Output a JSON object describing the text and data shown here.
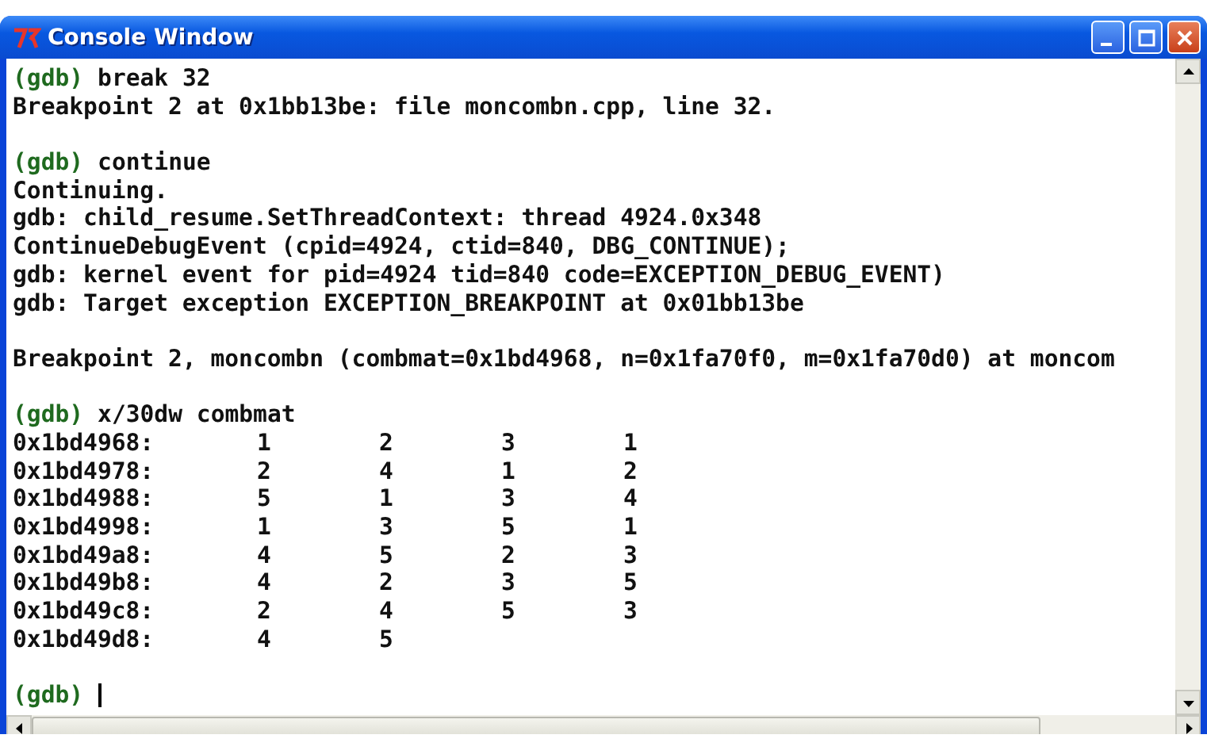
{
  "window": {
    "title": "Console Window"
  },
  "console": {
    "lines": [
      {
        "kind": "prompt",
        "prompt": "(gdb)",
        "command": "break 32"
      },
      {
        "kind": "output",
        "text": "Breakpoint 2 at 0x1bb13be: file moncombn.cpp, line 32."
      },
      {
        "kind": "blank"
      },
      {
        "kind": "prompt",
        "prompt": "(gdb)",
        "command": "continue"
      },
      {
        "kind": "output",
        "text": "Continuing."
      },
      {
        "kind": "output",
        "text": "gdb: child_resume.SetThreadContext: thread 4924.0x348"
      },
      {
        "kind": "output",
        "text": "ContinueDebugEvent (cpid=4924, ctid=840, DBG_CONTINUE);"
      },
      {
        "kind": "output",
        "text": "gdb: kernel event for pid=4924 tid=840 code=EXCEPTION_DEBUG_EVENT)"
      },
      {
        "kind": "output",
        "text": "gdb: Target exception EXCEPTION_BREAKPOINT at 0x01bb13be"
      },
      {
        "kind": "blank"
      },
      {
        "kind": "output",
        "text": "Breakpoint 2, moncombn (combmat=0x1bd4968, n=0x1fa70f0, m=0x1fa70d0) at moncom"
      },
      {
        "kind": "blank"
      },
      {
        "kind": "prompt",
        "prompt": "(gdb)",
        "command": "x/30dw combmat"
      },
      {
        "kind": "memory",
        "address": "0x1bd4968:",
        "values": [
          "1",
          "2",
          "3",
          "1"
        ]
      },
      {
        "kind": "memory",
        "address": "0x1bd4978:",
        "values": [
          "2",
          "4",
          "1",
          "2"
        ]
      },
      {
        "kind": "memory",
        "address": "0x1bd4988:",
        "values": [
          "5",
          "1",
          "3",
          "4"
        ]
      },
      {
        "kind": "memory",
        "address": "0x1bd4998:",
        "values": [
          "1",
          "3",
          "5",
          "1"
        ]
      },
      {
        "kind": "memory",
        "address": "0x1bd49a8:",
        "values": [
          "4",
          "5",
          "2",
          "3"
        ]
      },
      {
        "kind": "memory",
        "address": "0x1bd49b8:",
        "values": [
          "4",
          "2",
          "3",
          "5"
        ]
      },
      {
        "kind": "memory",
        "address": "0x1bd49c8:",
        "values": [
          "2",
          "4",
          "5",
          "3"
        ]
      },
      {
        "kind": "memory",
        "address": "0x1bd49d8:",
        "values": [
          "4",
          "5"
        ]
      },
      {
        "kind": "blank"
      },
      {
        "kind": "input",
        "prompt": "(gdb)"
      }
    ]
  }
}
